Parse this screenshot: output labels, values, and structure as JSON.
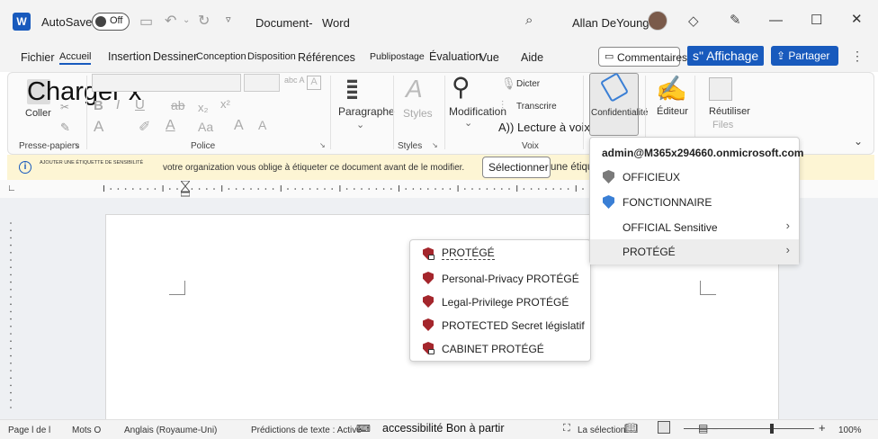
{
  "titlebar": {
    "autosave_label": "AutoSave",
    "autosave_state": "Off",
    "doc_title": "Document-",
    "app_name": "Word",
    "user_name": "Allan DeYoung"
  },
  "tabs": {
    "items": [
      "Fichier",
      "Accueil",
      "Insertion",
      "Dessiner",
      "Conception",
      "Disposition",
      "Références",
      "Publipostage",
      "Évaluation",
      "Vue",
      "Aide"
    ],
    "comments": "Commentaires",
    "affichage": "s\" Affichage",
    "share": "Partager"
  },
  "ribbon": {
    "big_text": "Charger x",
    "coller": "Coller",
    "presse_papiers": "Presse-papiers",
    "police": "Police",
    "paragraphe": "Paragraphe",
    "styles": "Styles",
    "styles_group": "Styles",
    "modification": "Modification",
    "dicter": "Dicter",
    "transcrire": "Transcrire",
    "lecture": "A)) Lecture à voix haute",
    "voix": "Voix",
    "confidentialite": "Confidentialité",
    "editeur": "Éditeur",
    "reutiliser": "Réutiliser",
    "files": "Files"
  },
  "infobar": {
    "small_label": "AJOUTER UNE ÉTIQUETTE DE SENSIBILITÉ",
    "message": "votre organization vous oblige à étiqueter ce document avant de le modifier.",
    "select_btn": "Sélectionner",
    "tail": "une étiquette"
  },
  "menu_main": {
    "account": "admin@M365x294660.onmicrosoft.com",
    "items": [
      {
        "label": "OFFICIEUX",
        "icon": "shield-grey-icon"
      },
      {
        "label": "FONCTIONNAIRE",
        "icon": "shield-blue-icon"
      },
      {
        "label": "OFFICIAL Sensitive",
        "icon": ""
      },
      {
        "label": "PROTÉGÉ",
        "icon": ""
      }
    ]
  },
  "menu_sub": {
    "items": [
      {
        "label": "PROTÉGÉ"
      },
      {
        "label": "Personal-Privacy PROTÉGÉ"
      },
      {
        "label": "Legal-Privilege PROTÉGÉ"
      },
      {
        "label": "PROTECTED Secret législatif"
      },
      {
        "label": "CABINET PROTÉGÉ"
      }
    ]
  },
  "statusbar": {
    "page": "Page l de l",
    "words": "Mots O",
    "language": "Anglais (Royaume-Uni)",
    "predictions": "Prédictions de texte : Activé",
    "accessibility": "accessibilité Bon à partir",
    "focus": "La sélection",
    "zoom": "100%"
  },
  "colors": {
    "accent": "#185abd",
    "protected_red": "#a4262c",
    "info_bar": "#fdf5d4"
  }
}
